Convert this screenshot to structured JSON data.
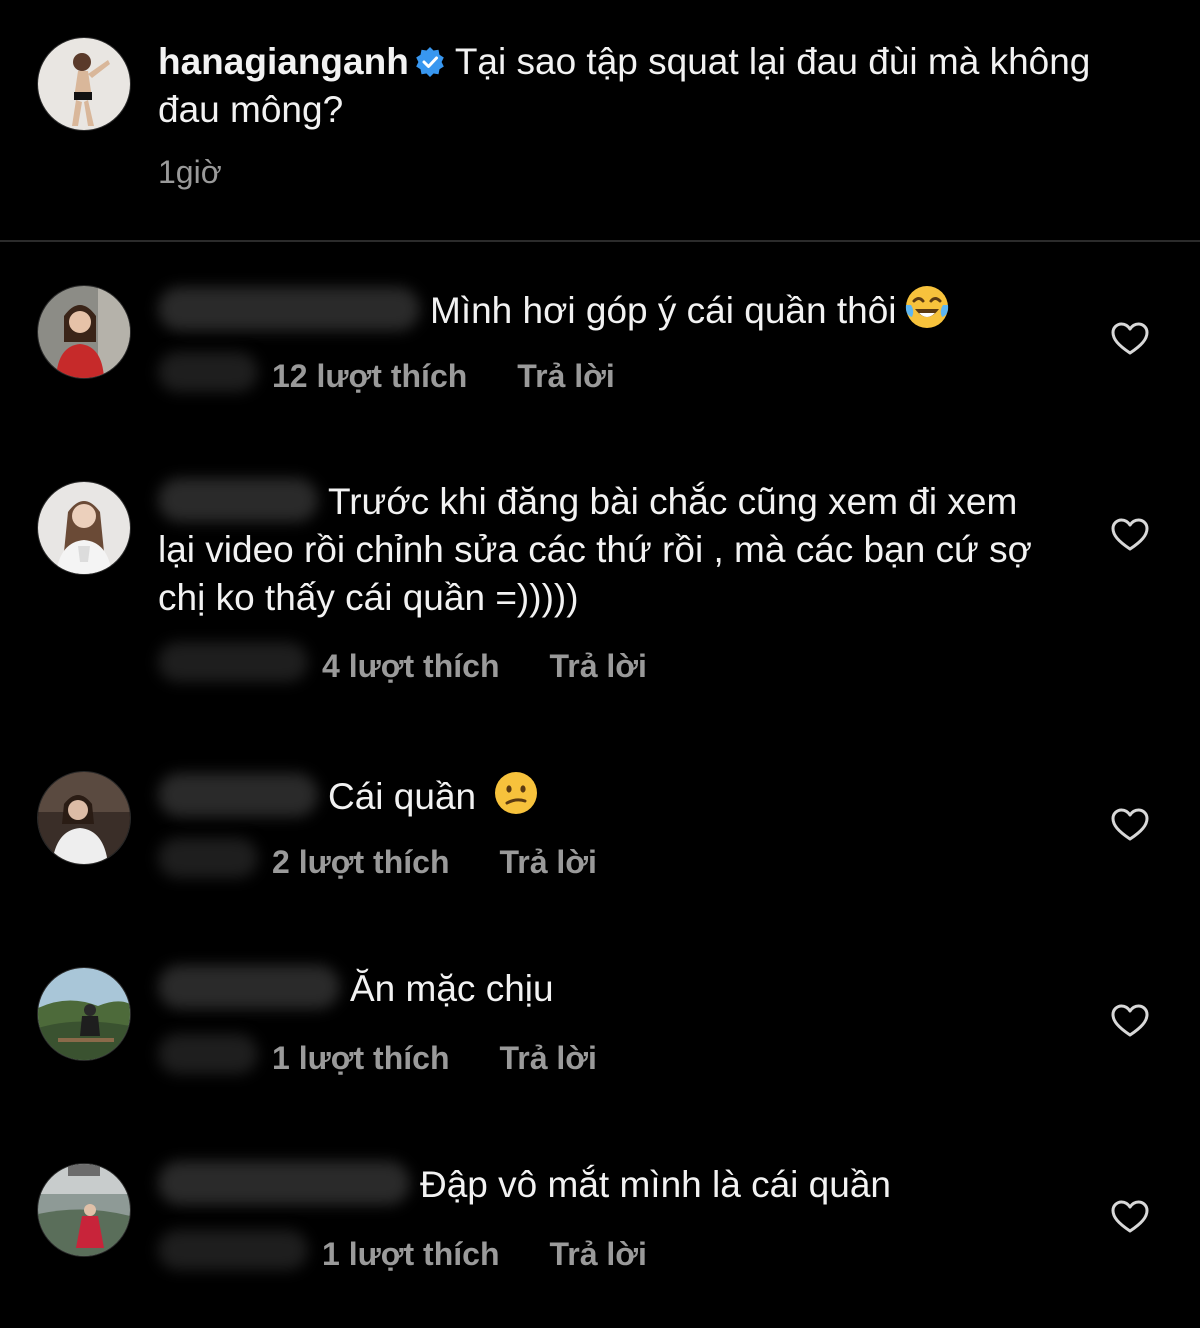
{
  "caption": {
    "username": "hanagianganh",
    "text": "Tại sao tập squat lại đau đùi mà không đau mông?",
    "time": "1giờ"
  },
  "comments": [
    {
      "text": "Mình hơi góp ý cái quần thôi",
      "emoji": "laughing-tears-emoji",
      "likes": "12 lượt thích",
      "reply": "Trả lời"
    },
    {
      "text": "Trước khi đăng bài chắc cũng xem đi xem lại video rồi chỉnh sửa các thứ rồi , mà các bạn cứ sợ chị ko thấy cái quần =)))))",
      "likes": "4 lượt thích",
      "reply": "Trả lời"
    },
    {
      "text": "Cái quần",
      "emoji": "confused-face-emoji",
      "likes": "2 lượt thích",
      "reply": "Trả lời"
    },
    {
      "text": "Ăn mặc chịu",
      "likes": "1 lượt thích",
      "reply": "Trả lời"
    },
    {
      "text": "Đập vô mắt mình là cái quần",
      "likes": "1 lượt thích",
      "reply": "Trả lời"
    }
  ],
  "colors": {
    "background": "#000000",
    "text": "#f2f2f2",
    "muted": "#9a9a9a",
    "verified": "#3897f0"
  }
}
